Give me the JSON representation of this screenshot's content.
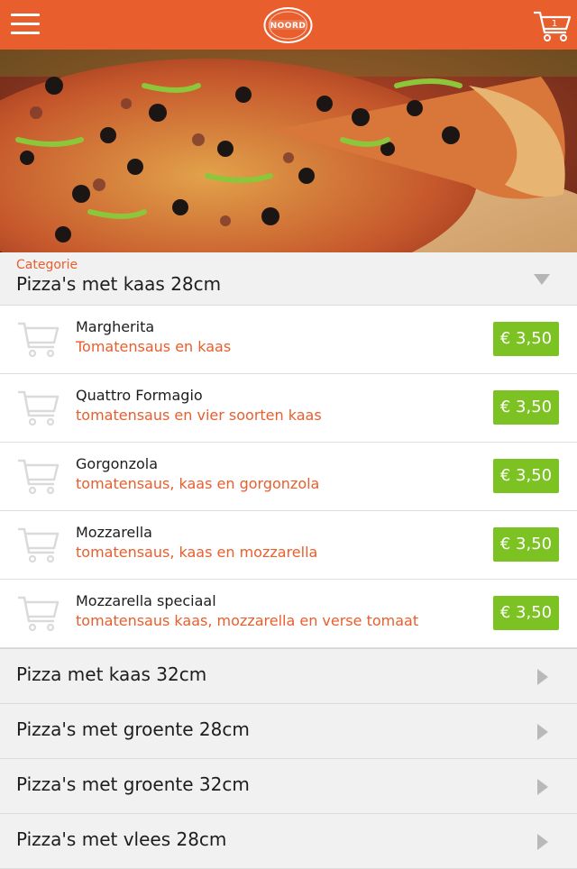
{
  "colors": {
    "header": "#e95e2d",
    "accent": "#e95e2d",
    "price_badge": "#7cc222"
  },
  "header": {
    "menu_icon": "hamburger-icon",
    "logo_text": "NOORD",
    "cart_icon": "shopping-cart-icon",
    "cart_count": "1"
  },
  "hero": {
    "image": "pizza-photo"
  },
  "category": {
    "label": "Categorie",
    "selected": "Pizza's met kaas 28cm",
    "icon": "dropdown-triangle-icon"
  },
  "items": [
    {
      "name": "Margherita",
      "description": "Tomatensaus en kaas",
      "price": "€ 3,50"
    },
    {
      "name": "Quattro Formagio",
      "description": "tomatensaus en vier soorten kaas",
      "price": "€ 3,50"
    },
    {
      "name": "Gorgonzola",
      "description": "tomatensaus, kaas en gorgonzola",
      "price": "€ 3,50"
    },
    {
      "name": "Mozzarella",
      "description": "tomatensaus, kaas en mozzarella",
      "price": "€ 3,50"
    },
    {
      "name": "Mozzarella speciaal",
      "description": "tomatensaus kaas, mozzarella en verse tomaat",
      "price": "€ 3,50"
    }
  ],
  "other_categories": [
    {
      "label": "Pizza met kaas 32cm"
    },
    {
      "label": "Pizza's met groente 28cm"
    },
    {
      "label": "Pizza's met groente 32cm"
    },
    {
      "label": "Pizza's met vlees 28cm"
    }
  ]
}
